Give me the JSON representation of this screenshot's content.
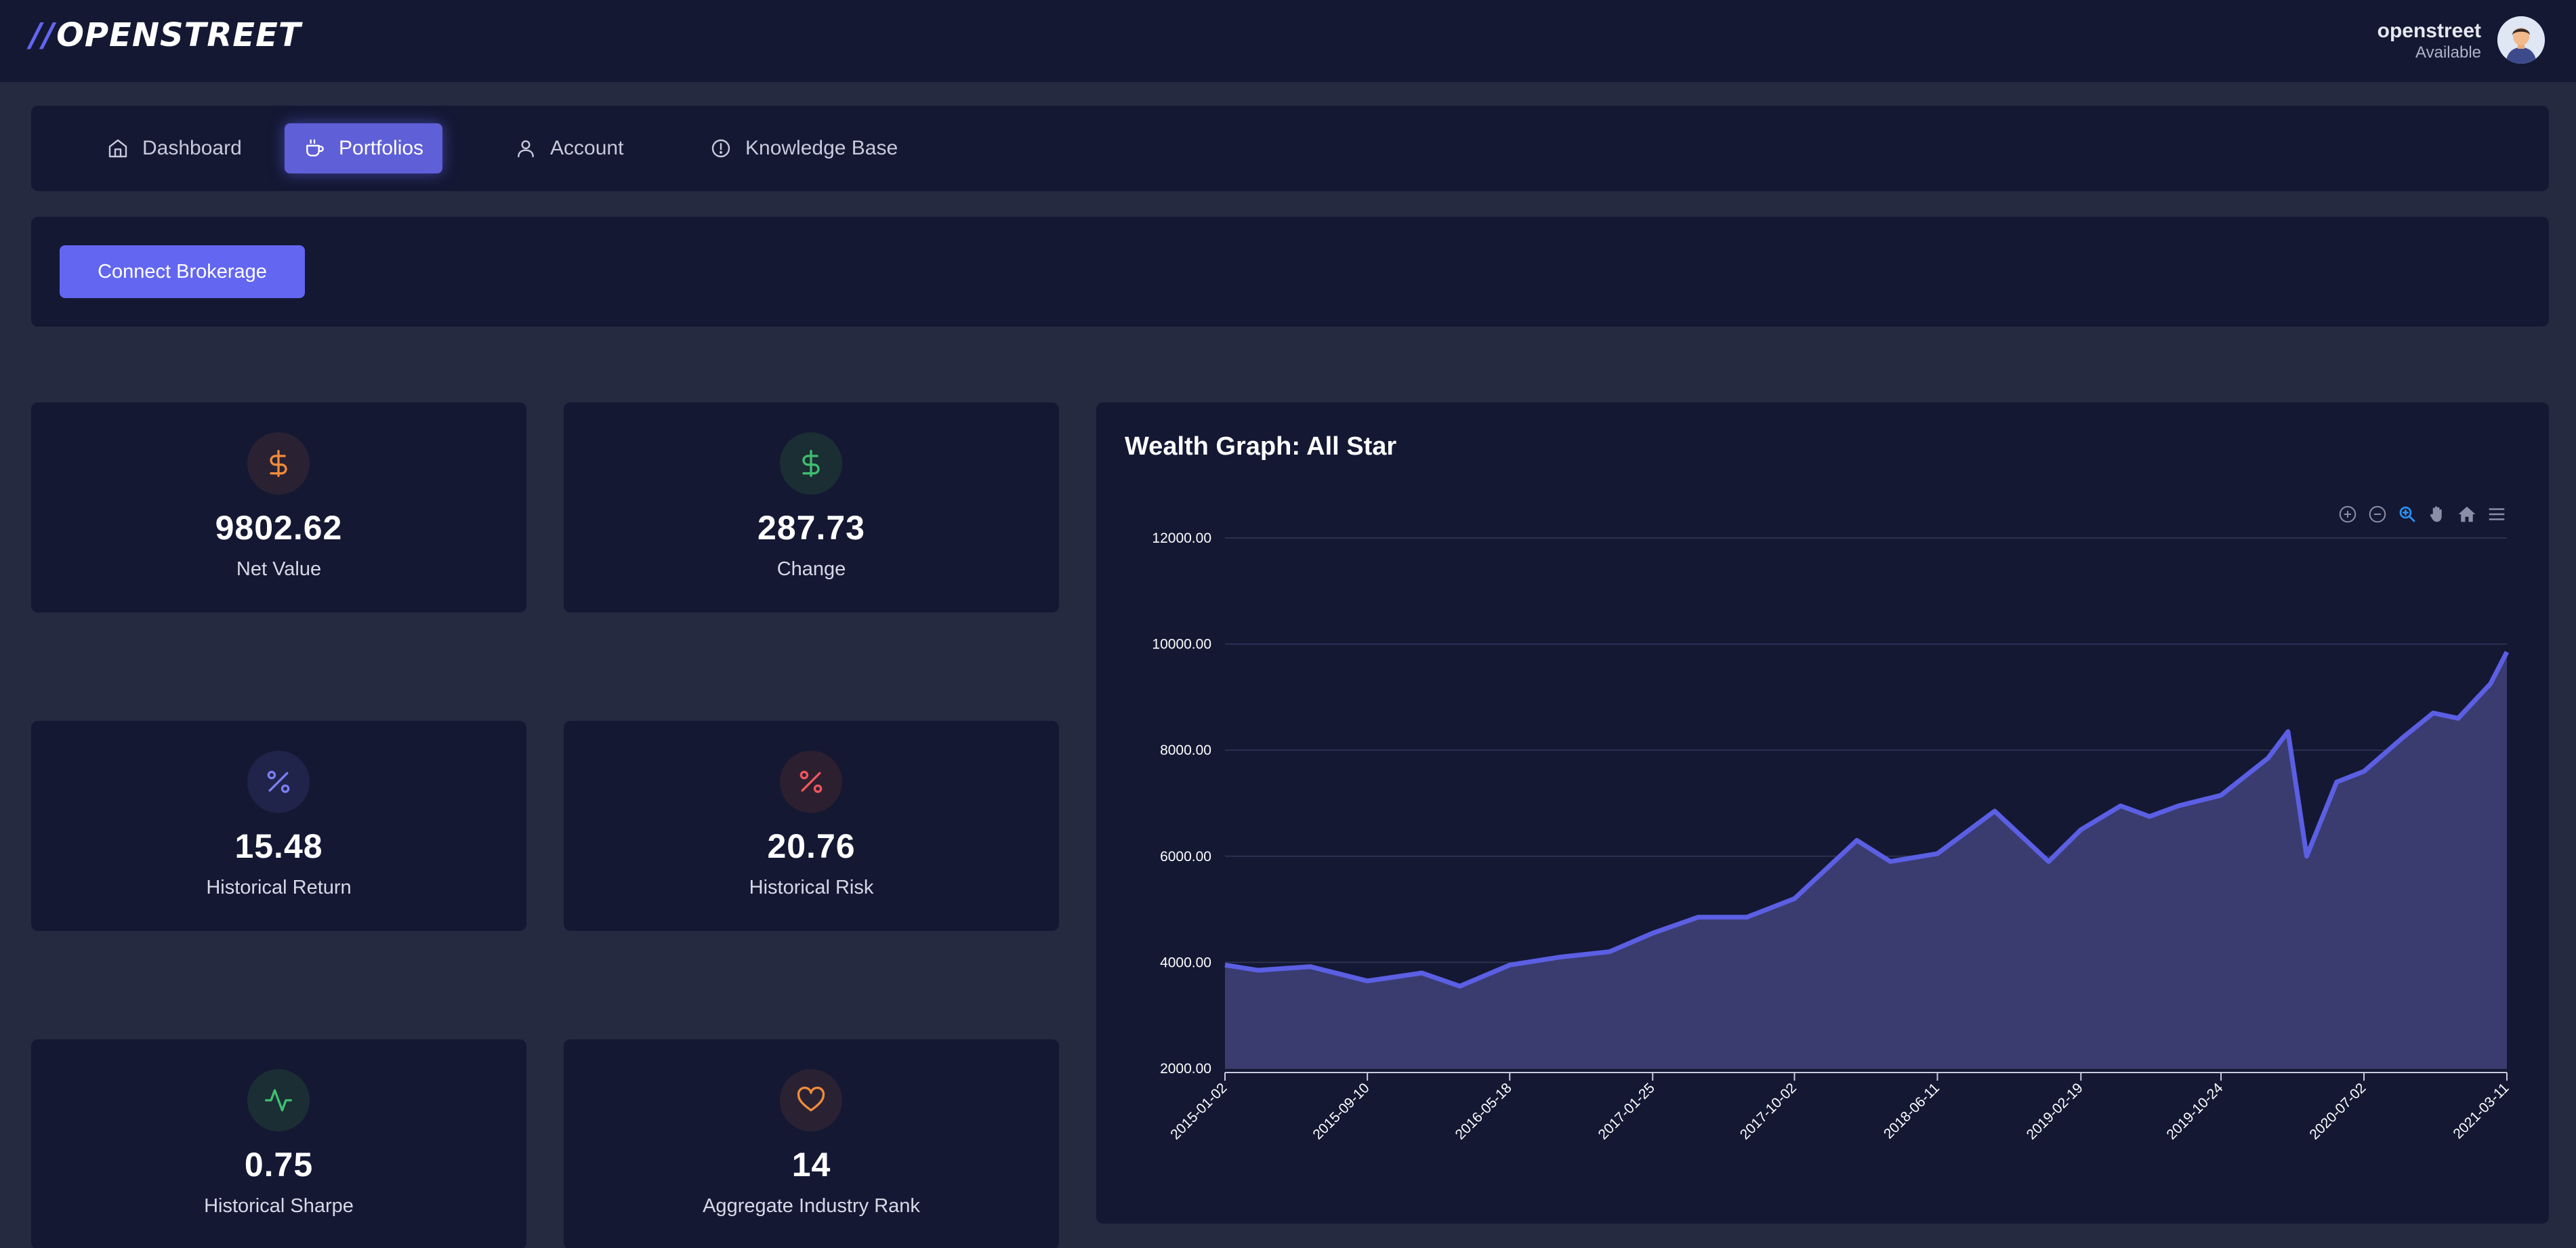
{
  "header": {
    "logo_slashes": "//",
    "logo_text": "OPENSTREET",
    "user_name": "openstreet",
    "user_status": "Available"
  },
  "nav": {
    "items": [
      {
        "label": "Dashboard",
        "icon": "home-icon",
        "active": false
      },
      {
        "label": "Portfolios",
        "icon": "coffee-icon",
        "active": true
      },
      {
        "label": "Account",
        "icon": "user-icon",
        "active": false
      },
      {
        "label": "Knowledge Base",
        "icon": "info-icon",
        "active": false
      }
    ]
  },
  "connect": {
    "button_label": "Connect Brokerage"
  },
  "stats": [
    {
      "value": "9802.62",
      "label": "Net Value",
      "icon": "dollar-icon",
      "color": "#f08c3a"
    },
    {
      "value": "287.73",
      "label": "Change",
      "icon": "dollar-icon",
      "color": "#3fbf6f"
    },
    {
      "value": "15.48",
      "label": "Historical Return",
      "icon": "percent-icon",
      "color": "#7b7ff2"
    },
    {
      "value": "20.76",
      "label": "Historical Risk",
      "icon": "percent-icon",
      "color": "#f0565c"
    },
    {
      "value": "0.75",
      "label": "Historical Sharpe",
      "icon": "activity-icon",
      "color": "#3fbf6f"
    },
    {
      "value": "14",
      "label": "Aggregate Industry Rank",
      "icon": "heart-icon",
      "color": "#f08c3a"
    }
  ],
  "colors": {
    "accent": "#6366f1",
    "card_bg": "#141833",
    "page_bg": "#252a40",
    "series": "#5b5fe3",
    "area_fill": "#3c3e73"
  },
  "chart_toolbar": [
    "zoom-in-icon",
    "zoom-out-icon",
    "selection-zoom-icon",
    "pan-hand-icon",
    "reset-home-icon",
    "menu-icon"
  ],
  "chart_data": {
    "type": "area",
    "title": "Wealth Graph: All Star",
    "xlabel": "",
    "ylabel": "",
    "ylim": [
      2000,
      12000
    ],
    "yticks": [
      "2000.00",
      "4000.00",
      "6000.00",
      "8000.00",
      "10000.00",
      "12000.00"
    ],
    "xticks": [
      "2015-01-02",
      "2015-09-10",
      "2016-05-18",
      "2017-01-25",
      "2017-10-02",
      "2018-06-11",
      "2019-02-19",
      "2019-10-24",
      "2020-07-02",
      "2021-03-11"
    ],
    "grid": true,
    "series": [
      {
        "values_by_tick": [
          {
            "x": "2015-01-02",
            "y": 3950
          },
          {
            "x": "2015-03-01",
            "y": 3850
          },
          {
            "x": "2015-06-01",
            "y": 3920
          },
          {
            "x": "2015-09-10",
            "y": 3650
          },
          {
            "x": "2015-12-15",
            "y": 3800
          },
          {
            "x": "2016-02-20",
            "y": 3550
          },
          {
            "x": "2016-05-18",
            "y": 3950
          },
          {
            "x": "2016-08-15",
            "y": 4100
          },
          {
            "x": "2016-11-10",
            "y": 4200
          },
          {
            "x": "2017-01-25",
            "y": 4550
          },
          {
            "x": "2017-04-15",
            "y": 4850
          },
          {
            "x": "2017-07-10",
            "y": 4850
          },
          {
            "x": "2017-10-02",
            "y": 5200
          },
          {
            "x": "2018-01-20",
            "y": 6300
          },
          {
            "x": "2018-03-20",
            "y": 5900
          },
          {
            "x": "2018-06-11",
            "y": 6050
          },
          {
            "x": "2018-09-20",
            "y": 6850
          },
          {
            "x": "2018-12-24",
            "y": 5900
          },
          {
            "x": "2019-02-19",
            "y": 6500
          },
          {
            "x": "2019-04-30",
            "y": 6950
          },
          {
            "x": "2019-06-20",
            "y": 6750
          },
          {
            "x": "2019-08-10",
            "y": 6950
          },
          {
            "x": "2019-10-24",
            "y": 7150
          },
          {
            "x": "2020-01-15",
            "y": 7850
          },
          {
            "x": "2020-02-19",
            "y": 8350
          },
          {
            "x": "2020-03-23",
            "y": 6000
          },
          {
            "x": "2020-05-15",
            "y": 7400
          },
          {
            "x": "2020-07-02",
            "y": 7600
          },
          {
            "x": "2020-09-10",
            "y": 8250
          },
          {
            "x": "2020-11-01",
            "y": 8700
          },
          {
            "x": "2020-12-15",
            "y": 8600
          },
          {
            "x": "2021-02-10",
            "y": 9250
          },
          {
            "x": "2021-03-11",
            "y": 9850
          }
        ]
      }
    ]
  }
}
